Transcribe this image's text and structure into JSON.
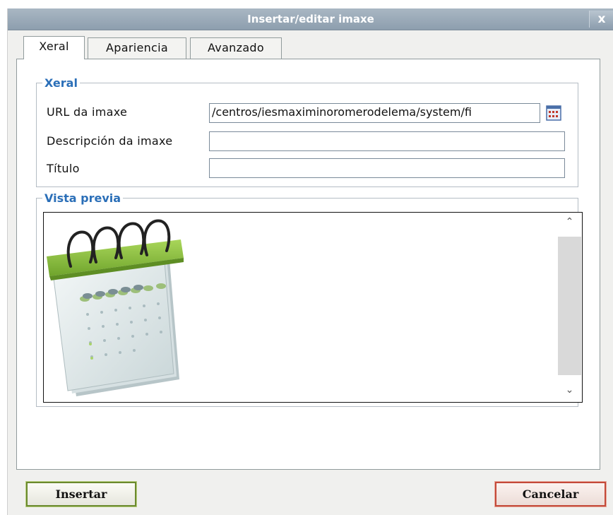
{
  "dialog": {
    "title": "Insertar/editar imaxe",
    "close_glyph": "x"
  },
  "tabs": [
    {
      "label": "Xeral",
      "active": true
    },
    {
      "label": "Apariencia",
      "active": false
    },
    {
      "label": "Avanzado",
      "active": false
    }
  ],
  "general": {
    "legend": "Xeral",
    "url_label": "URL da imaxe",
    "url_value": "/centros/iesmaximinoromerodelema/system/fi",
    "description_label": "Descripción da imaxe",
    "description_value": "",
    "title_label": "Título",
    "title_value": ""
  },
  "preview": {
    "legend": "Vista previa",
    "image": "calendar-icon"
  },
  "buttons": {
    "insert": "Insertar",
    "cancel": "Cancelar"
  },
  "colors": {
    "accent": "#2b6fb8",
    "insert_border": "#6b8a2e",
    "cancel_border": "#c44a3a",
    "calendar_green": "#8cc63f"
  }
}
